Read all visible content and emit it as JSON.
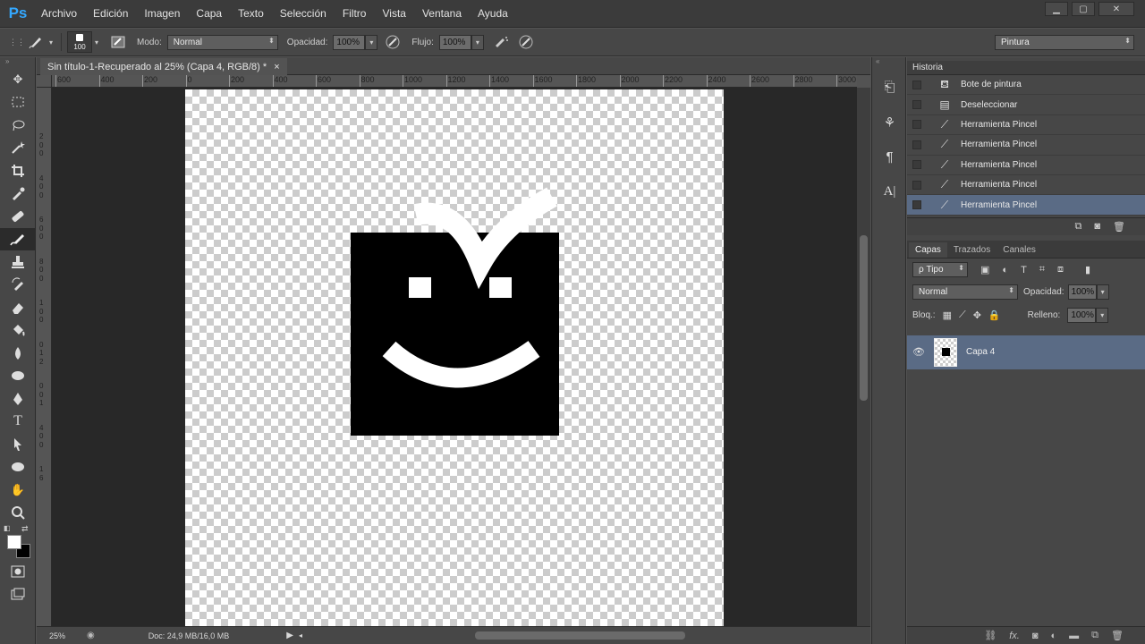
{
  "app": {
    "logo": "Ps"
  },
  "menu": [
    "Archivo",
    "Edición",
    "Imagen",
    "Capa",
    "Texto",
    "Selección",
    "Filtro",
    "Vista",
    "Ventana",
    "Ayuda"
  ],
  "window_controls": {
    "minimize": "▁",
    "maximize": "▢",
    "close": "✕"
  },
  "options": {
    "brush_size": "100",
    "mode_label": "Modo:",
    "mode_value": "Normal",
    "opacity_label": "Opacidad:",
    "opacity_value": "100%",
    "flow_label": "Flujo:",
    "flow_value": "100%",
    "workspace": "Pintura"
  },
  "document": {
    "tab_title": "Sin título-1-Recuperado al 25% (Capa 4, RGB/8) *",
    "close": "×",
    "ruler_labels": [
      "600",
      "400",
      "200",
      "0",
      "200",
      "400",
      "600",
      "800",
      "1000",
      "1200",
      "1400",
      "1600",
      "1800",
      "2000",
      "2200",
      "2400",
      "2600",
      "2800",
      "3000"
    ],
    "vruler_labels": [
      "2",
      "0",
      "0",
      "4",
      "0",
      "0",
      "6",
      "0",
      "0",
      "8",
      "0",
      "0",
      "1",
      "0",
      "0",
      "0",
      "1",
      "2",
      "0",
      "0",
      "1",
      "4",
      "0",
      "0",
      "1",
      "6"
    ],
    "zoom": "25%",
    "doc_info": "Doc: 24,9 MB/16,0 MB"
  },
  "history": {
    "title": "Historia",
    "items": [
      {
        "label": "Bote de pintura",
        "icon": "paint-bucket-icon",
        "selected": false
      },
      {
        "label": "Deseleccionar",
        "icon": "document-icon",
        "selected": false
      },
      {
        "label": "Herramienta Pincel",
        "icon": "brush-icon",
        "selected": false
      },
      {
        "label": "Herramienta Pincel",
        "icon": "brush-icon",
        "selected": false
      },
      {
        "label": "Herramienta Pincel",
        "icon": "brush-icon",
        "selected": false
      },
      {
        "label": "Herramienta Pincel",
        "icon": "brush-icon",
        "selected": false
      },
      {
        "label": "Herramienta Pincel",
        "icon": "brush-icon",
        "selected": true
      }
    ]
  },
  "layers": {
    "tabs": [
      "Capas",
      "Trazados",
      "Canales"
    ],
    "filter_label": "ρ Tipo",
    "blend_mode": "Normal",
    "opacity_label": "Opacidad:",
    "opacity_value": "100%",
    "lock_label": "Bloq.:",
    "fill_label": "Relleno:",
    "fill_value": "100%",
    "items": [
      {
        "name": "Capa 4",
        "visible": true,
        "selected": true
      }
    ]
  },
  "colors": {
    "foreground": "#ffffff",
    "background": "#000000",
    "selection": "#5a6b85",
    "ps_blue": "#34a8ff"
  }
}
